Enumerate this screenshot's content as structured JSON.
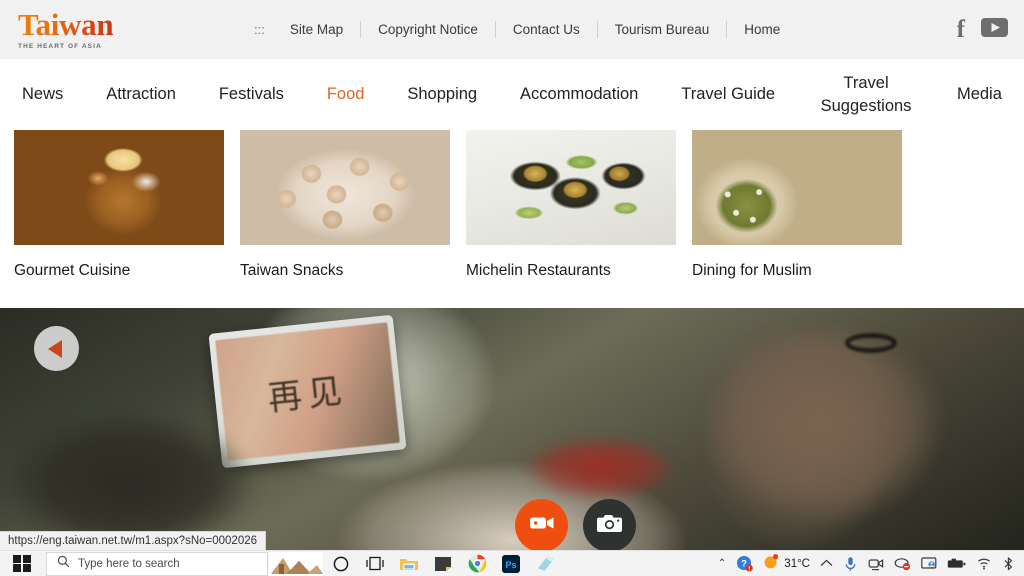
{
  "site": {
    "logo_main": "Taiwan",
    "logo_sub": "THE HEART OF ASIA",
    "accent_color": "#e2622a",
    "logo_gradient_from": "#e8820c",
    "logo_gradient_to": "#c93412"
  },
  "utility_nav": {
    "dots": ":::",
    "items": [
      {
        "label": "Site Map"
      },
      {
        "label": "Copyright Notice"
      },
      {
        "label": "Contact Us"
      },
      {
        "label": "Tourism Bureau"
      },
      {
        "label": "Home"
      }
    ],
    "social": [
      {
        "name": "facebook-icon",
        "glyph": "f"
      },
      {
        "name": "youtube-icon",
        "glyph": "▶"
      }
    ]
  },
  "main_nav": {
    "items": [
      {
        "label": "News",
        "active": false
      },
      {
        "label": "Attraction",
        "active": false
      },
      {
        "label": "Festivals",
        "active": false
      },
      {
        "label": "Food",
        "active": true
      },
      {
        "label": "Shopping",
        "active": false
      },
      {
        "label": "Accommodation",
        "active": false
      },
      {
        "label": "Travel Guide",
        "active": false
      },
      {
        "label": "Travel Suggestions",
        "active": false
      },
      {
        "label": "Media",
        "active": false
      }
    ]
  },
  "cards": [
    {
      "label": "Gourmet Cuisine",
      "image": "clay-pot-soup-photo"
    },
    {
      "label": "Taiwan Snacks",
      "image": "steamer-dumplings-photo"
    },
    {
      "label": "Michelin Restaurants",
      "image": "abalone-dish-photo"
    },
    {
      "label": "Dining for Muslim",
      "image": "halal-plate-photo"
    }
  ],
  "hero": {
    "image": "people-dining-with-tablet-video-still",
    "tablet_text": "再见",
    "prev_arrow": "◀",
    "video_button": "video-camera-icon",
    "photo_button": "camera-icon"
  },
  "status_bar": {
    "url": "https://eng.taiwan.net.tw/m1.aspx?sNo=0002026"
  },
  "taskbar": {
    "start": "windows-start-icon",
    "search_placeholder": "Type here to search",
    "pinned": [
      {
        "name": "taskbar-thumbnail-preview"
      },
      {
        "name": "cortana-icon"
      },
      {
        "name": "task-view-icon"
      },
      {
        "name": "file-explorer-icon"
      },
      {
        "name": "sticky-notes-icon"
      },
      {
        "name": "google-chrome-icon"
      },
      {
        "name": "photoshop-icon",
        "glyph": "Ps"
      },
      {
        "name": "book-app-icon"
      }
    ],
    "tray": {
      "overflow_chevron": "⌃",
      "temperature": "31°C",
      "items": [
        {
          "name": "help-icon"
        },
        {
          "name": "weather-sun-icon"
        },
        {
          "name": "show-hidden-icons-chevron"
        },
        {
          "name": "microphone-icon"
        },
        {
          "name": "webcam-icon"
        },
        {
          "name": "recording-blocked-icon"
        },
        {
          "name": "display-settings-icon"
        },
        {
          "name": "battery-icon"
        },
        {
          "name": "wifi-icon"
        },
        {
          "name": "bluetooth-icon"
        }
      ]
    }
  }
}
